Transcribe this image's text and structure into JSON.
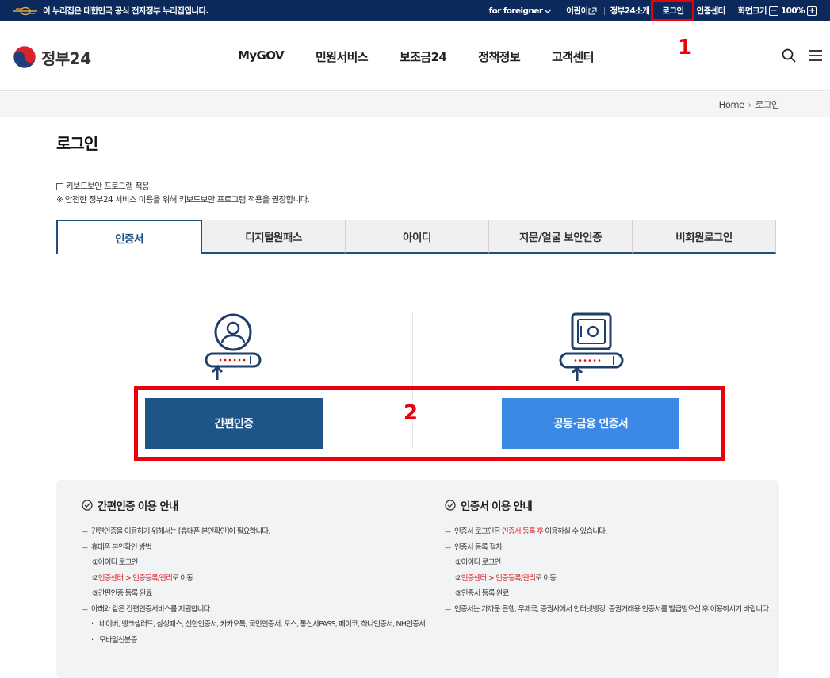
{
  "topbar": {
    "gov_notice": "이 누리집은 대한민국 공식 전자정부 누리집입니다.",
    "util": {
      "foreigner": "for foreigner",
      "kids": "어린이",
      "about": "정부24소개",
      "login": "로그인",
      "cert_center": "인증센터",
      "screen_size": "화면크기",
      "zoom": "100%"
    }
  },
  "header": {
    "logo": "정부24",
    "nav": [
      "MyGOV",
      "민원서비스",
      "보조금24",
      "정책정보",
      "고객센터"
    ]
  },
  "annotations": {
    "one": "1",
    "two": "2"
  },
  "breadcrumb": {
    "home": "Home",
    "current": "로그인"
  },
  "page_title": "로그인",
  "keyboard": {
    "checkbox_label": "키보드보안 프로그램 적용",
    "notice": "※ 안전한 정부24 서비스 이용을 위해 키보드보안 프로그램 적용을 권장합니다."
  },
  "tabs": [
    "인증서",
    "디지털원패스",
    "아이디",
    "지문/얼굴 보안인증",
    "비회원로그인"
  ],
  "buttons": {
    "simple": "간편인증",
    "cert": "공동·금융 인증서"
  },
  "info": {
    "left": {
      "title": "간편인증 이용 안내",
      "l1": "간편인증을 이용하기 위해서는 [휴대폰 본인확인]이 필요합니다.",
      "l2": "휴대폰 본인확인 방법",
      "l3": "①아이디 로그인",
      "l4a": "②",
      "l4b": "인증센터 > 인증등록/관리",
      "l4c": "로 이동",
      "l5": "③간편인증 등록 완료",
      "l6": "아래와 같은 간편인증서비스를 지원합니다.",
      "l7": "네이버, 뱅크샐러드, 삼성패스, 신한인증서, 카카오톡, 국민인증서, 토스, 통신사PASS, 페이코, 하나인증서, NH인증서",
      "l8": "모바일신분증"
    },
    "right": {
      "title": "인증서 이용 안내",
      "l1a": "인증서 로그인은 ",
      "l1b": "인증서 등록 후",
      "l1c": " 이용하실 수 있습니다.",
      "l2": "인증서 등록 절차",
      "l3": "①아이디 로그인",
      "l4a": "②",
      "l4b": "인증센터 > 인증등록/관리",
      "l4c": "로 이동",
      "l5": "③인증서 등록 완료",
      "l6": "인증서는 가까운 은행, 우체국, 증권사에서 인터넷뱅킹, 증권거래용 인증서를 발급받으신 후 이용하시기 바랍니다."
    }
  },
  "colors": {
    "navy": "#0b2a5b",
    "primary": "#1f5488",
    "accent": "#3b89e4",
    "annotation": "#e8000b"
  }
}
